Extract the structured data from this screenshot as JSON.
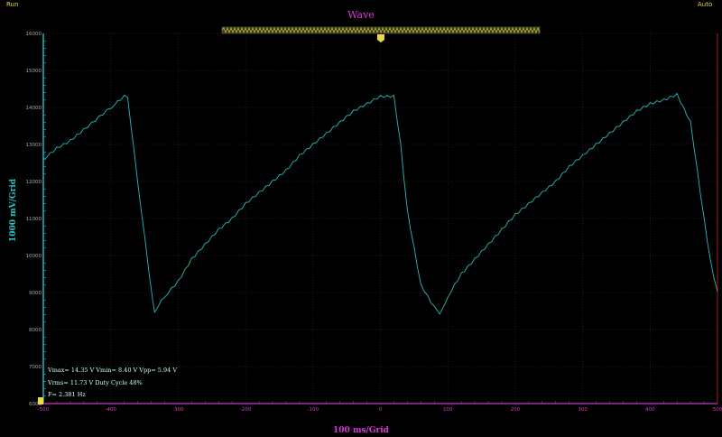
{
  "status": {
    "run": "Run",
    "auto": "Auto"
  },
  "title": "Wave",
  "colors": {
    "trace": "#2ab8b8",
    "grid": "#3a3a3a",
    "axis": "#c13ec1",
    "yaxis": "#2ee0e0",
    "label": "#d63ad6",
    "marker": "#e8d84a"
  },
  "axes": {
    "ylabel": "1000 mV/Grid",
    "xlabel": "100 ms/Grid",
    "yticks": [
      "16000",
      "15000",
      "14000",
      "13000",
      "12000",
      "11000",
      "10000",
      "9000",
      "8000",
      "7000",
      "6000"
    ],
    "xticks": [
      "-500",
      "-400",
      "-300",
      "-200",
      "-100",
      "0",
      "100",
      "200",
      "300",
      "400",
      "500"
    ]
  },
  "measurements": {
    "line1": "Vmax= 14.35 V  Vmin= 8.40 V  Vpp= 5.94 V",
    "line2": "Vrms= 11.73 V  Duty Cycle 48%",
    "line3": "F= 2.381 Hz"
  },
  "chart_data": {
    "type": "line",
    "ylim": [
      6000,
      16000
    ],
    "xlim": [
      -500,
      500
    ],
    "grid": true,
    "series": [
      {
        "x": [
          -500,
          -480,
          -460,
          -440,
          -400,
          -380,
          -375,
          -360,
          -338,
          -335,
          -320,
          -300,
          -280,
          -260,
          -240,
          -220,
          -200,
          -180,
          -160,
          -140,
          -120,
          -100,
          -80,
          -60,
          -40,
          -20,
          0,
          20,
          30,
          40,
          60,
          80,
          88,
          95,
          100,
          120,
          140,
          160,
          180,
          200,
          220,
          240,
          260,
          280,
          300,
          320,
          340,
          360,
          380,
          400,
          420,
          440,
          460,
          480,
          490,
          500
        ],
        "y": [
          12600,
          12900,
          13100,
          13400,
          14000,
          14300,
          14300,
          12000,
          8800,
          8500,
          8900,
          9300,
          9900,
          10300,
          10700,
          11000,
          11400,
          11700,
          12000,
          12300,
          12700,
          13000,
          13300,
          13600,
          13900,
          14100,
          14300,
          14300,
          13000,
          11200,
          9200,
          8600,
          8450,
          8700,
          8900,
          9500,
          9900,
          10300,
          10700,
          11100,
          11400,
          11700,
          12000,
          12400,
          12700,
          13000,
          13300,
          13600,
          13900,
          14100,
          14200,
          14350,
          13600,
          11000,
          9800,
          9000
        ]
      }
    ]
  }
}
